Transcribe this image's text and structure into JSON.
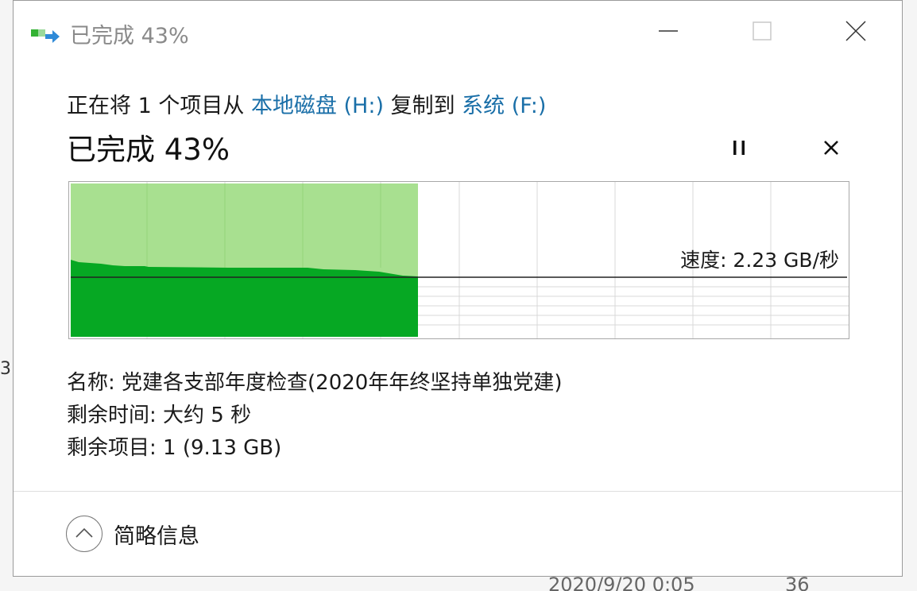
{
  "window": {
    "title": "已完成 43%",
    "minimize_icon": "minimize-icon",
    "maximize_icon": "maximize-icon",
    "close_icon": "close-icon"
  },
  "header": {
    "copy_prefix": "正在将 1 个项目从 ",
    "source": "本地磁盘 (H:)",
    "copy_middle": " 复制到 ",
    "destination": "系统 (F:)",
    "status": "已完成 43%"
  },
  "controls": {
    "pause_icon": "pause-icon",
    "cancel_icon": "cancel-icon"
  },
  "graph": {
    "progress_fraction": 0.43,
    "speed_label": "速度: 2.23 GB/秒",
    "colors": {
      "done_light": "#a8e090",
      "done_dark": "#06a823",
      "grid": "#d9d9d9",
      "speed_line": "#222222"
    }
  },
  "details": {
    "name_label": "名称: ",
    "name_value": "党建各支部年度检查(2020年年终坚持单独党建)",
    "time_label": "剩余时间: ",
    "time_value": "大约 5 秒",
    "items_label": "剩余项目: ",
    "items_value": "1 (9.13 GB)"
  },
  "footer": {
    "toggle_label": "简略信息",
    "toggle_icon": "chevron-up-icon"
  },
  "background": {
    "edge_fragment": "3",
    "date_fragment": "2020/9/20 0:05",
    "size_fragment": "36"
  }
}
